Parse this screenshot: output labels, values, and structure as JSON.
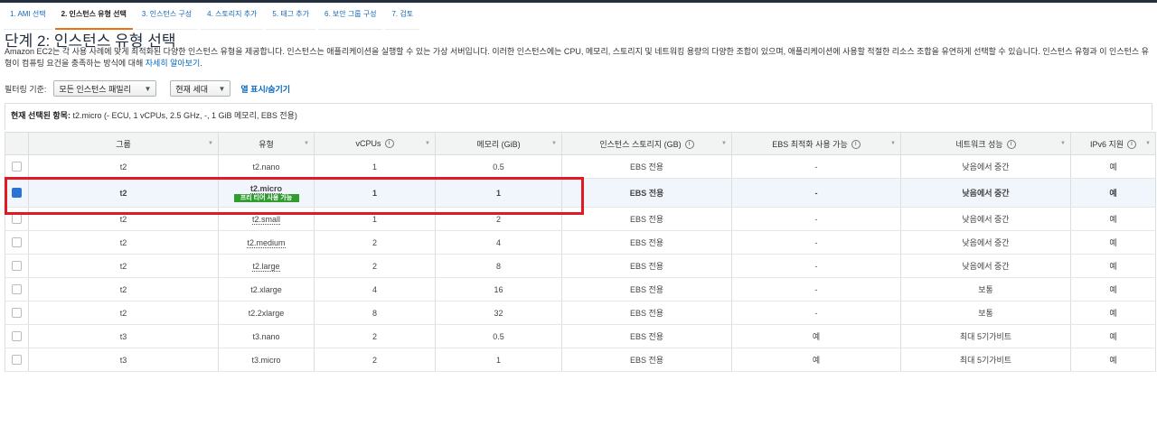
{
  "wizard": {
    "tabs": [
      {
        "label": "1. AMI 선택",
        "active": false
      },
      {
        "label": "2. 인스턴스 유형 선택",
        "active": true
      },
      {
        "label": "3. 인스턴스 구성",
        "active": false
      },
      {
        "label": "4. 스토리지 추가",
        "active": false
      },
      {
        "label": "5. 태그 추가",
        "active": false
      },
      {
        "label": "6. 보안 그룹 구성",
        "active": false
      },
      {
        "label": "7. 검토",
        "active": false
      }
    ]
  },
  "page": {
    "title": "단계 2: 인스턴스 유형 선택",
    "description": "Amazon EC2는 각 사용 사례에 맞게 최적화된 다양한 인스턴스 유형을 제공합니다. 인스턴스는 애플리케이션을 실행할 수 있는 가상 서버입니다. 이러한 인스턴스에는 CPU, 메모리, 스토리지 및 네트워킹 용량의 다양한 조합이 있으며, 애플리케이션에 사용할 적절한 리소스 조합을 유연하게 선택할 수 있습니다. 인스턴스 유형과 이 인스턴스 유형이 컴퓨팅 요건을 충족하는 방식에 대해 ",
    "learn_more": "자세히 알아보기",
    "learn_more_suffix": "."
  },
  "filters": {
    "label": "필터링 기준:",
    "family_value": "모든 인스턴스 패밀리",
    "generation_value": "현재 세대",
    "toggle_columns": "열 표시/숨기기"
  },
  "selected": {
    "label": "현재 선택된 항목:",
    "value": "t2.micro (- ECU, 1 vCPUs, 2.5 GHz, -, 1 GiB 메모리, EBS 전용)"
  },
  "table": {
    "headers": {
      "group": "그룹",
      "type": "유형",
      "vcpus": "vCPUs",
      "memory": "메모리 (GiB)",
      "storage": "인스턴스 스토리지 (GB)",
      "ebs_opt": "EBS 최적화 사용 가능",
      "network": "네트워크 성능",
      "ipv6": "IPv6 지원"
    },
    "free_tier_badge": "프리 티어 사용 가능",
    "rows": [
      {
        "group": "t2",
        "type": "t2.nano",
        "vcpus": "1",
        "memory": "0.5",
        "storage": "EBS 전용",
        "ebs_opt": "-",
        "network": "낮음에서 중간",
        "ipv6": "예",
        "selected": false
      },
      {
        "group": "t2",
        "type": "t2.micro",
        "vcpus": "1",
        "memory": "1",
        "storage": "EBS 전용",
        "ebs_opt": "-",
        "network": "낮음에서 중간",
        "ipv6": "예",
        "selected": true
      },
      {
        "group": "t2",
        "type": "t2.small",
        "vcpus": "1",
        "memory": "2",
        "storage": "EBS 전용",
        "ebs_opt": "-",
        "network": "낮음에서 중간",
        "ipv6": "예",
        "selected": false
      },
      {
        "group": "t2",
        "type": "t2.medium",
        "vcpus": "2",
        "memory": "4",
        "storage": "EBS 전용",
        "ebs_opt": "-",
        "network": "낮음에서 중간",
        "ipv6": "예",
        "selected": false
      },
      {
        "group": "t2",
        "type": "t2.large",
        "vcpus": "2",
        "memory": "8",
        "storage": "EBS 전용",
        "ebs_opt": "-",
        "network": "낮음에서 중간",
        "ipv6": "예",
        "selected": false
      },
      {
        "group": "t2",
        "type": "t2.xlarge",
        "vcpus": "4",
        "memory": "16",
        "storage": "EBS 전용",
        "ebs_opt": "-",
        "network": "보통",
        "ipv6": "예",
        "selected": false
      },
      {
        "group": "t2",
        "type": "t2.2xlarge",
        "vcpus": "8",
        "memory": "32",
        "storage": "EBS 전용",
        "ebs_opt": "-",
        "network": "보통",
        "ipv6": "예",
        "selected": false
      },
      {
        "group": "t3",
        "type": "t3.nano",
        "vcpus": "2",
        "memory": "0.5",
        "storage": "EBS 전용",
        "ebs_opt": "예",
        "network": "최대 5기가비트",
        "ipv6": "예",
        "selected": false
      },
      {
        "group": "t3",
        "type": "t3.micro",
        "vcpus": "2",
        "memory": "1",
        "storage": "EBS 전용",
        "ebs_opt": "예",
        "network": "최대 5기가비트",
        "ipv6": "예",
        "selected": false
      }
    ]
  },
  "colors": {
    "accent": "#ec7211",
    "link": "#0066c0",
    "highlight": "#e01a22",
    "free_tier": "#2f9e2f"
  }
}
